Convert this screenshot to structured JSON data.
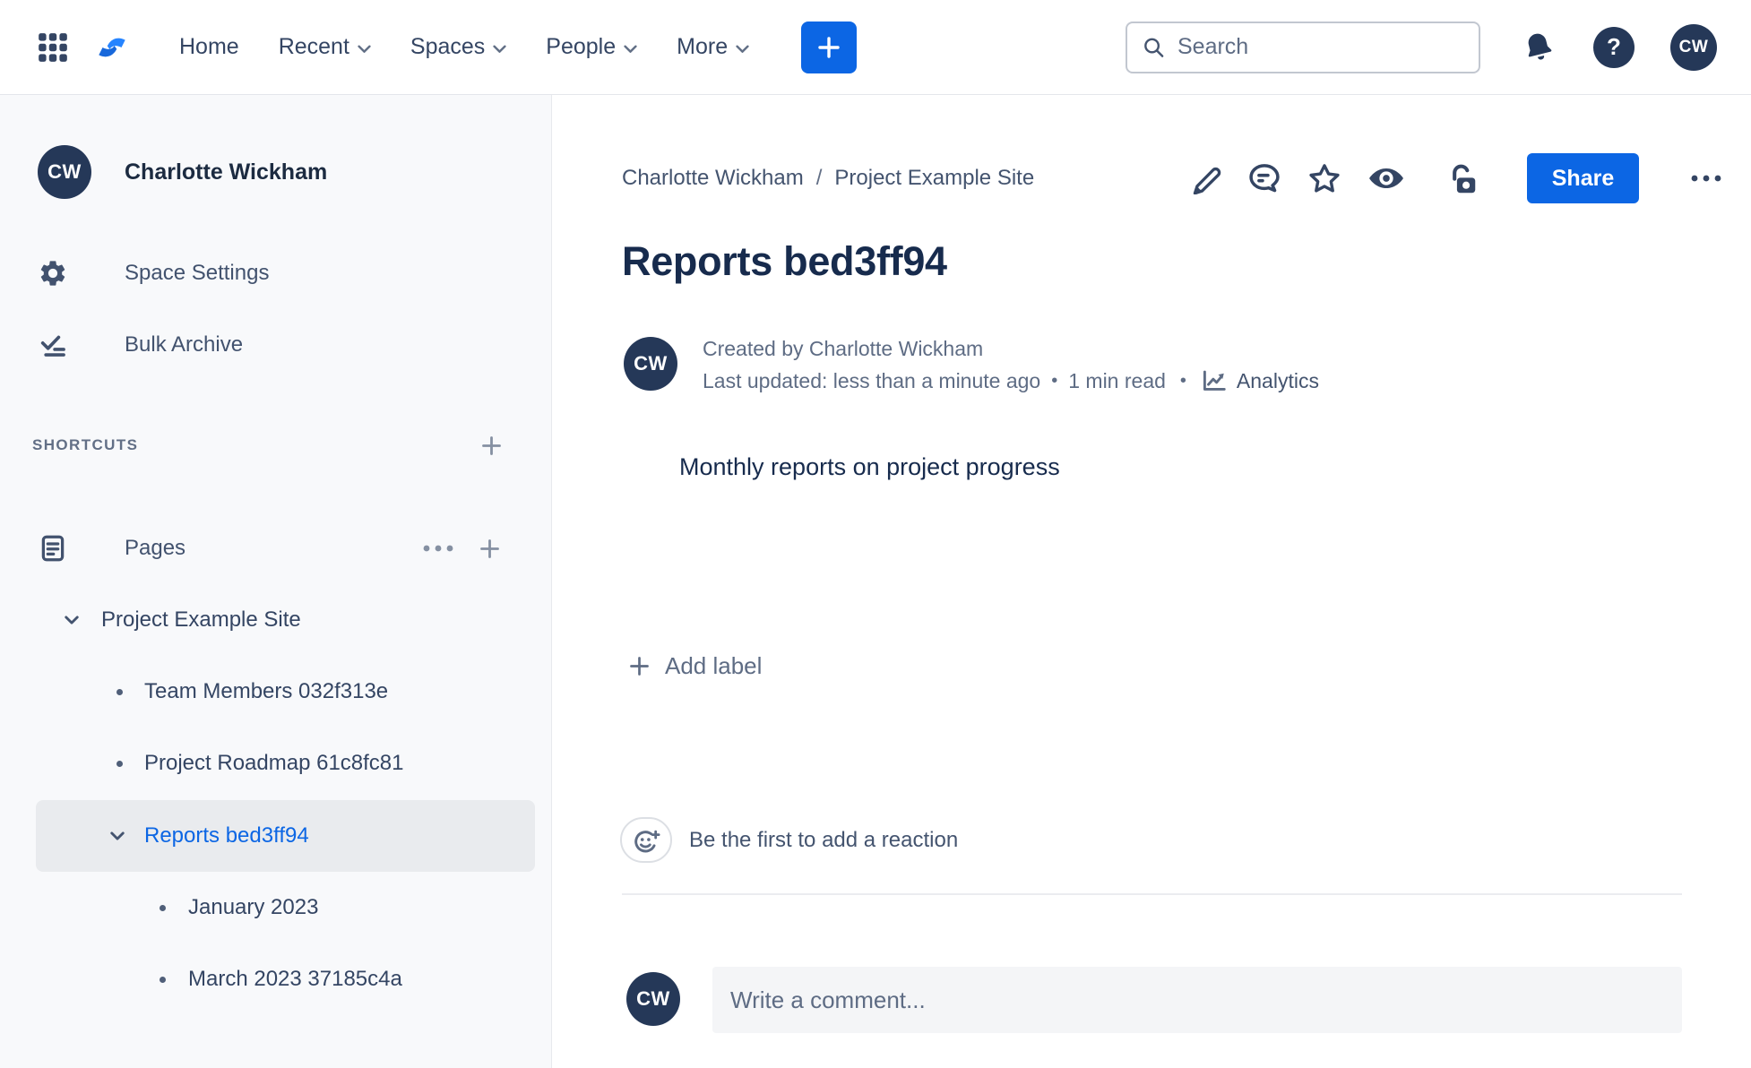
{
  "colors": {
    "accent": "#0C66E4",
    "title_text": "#172B4D",
    "nav_text": "#344563",
    "sidebar_text": "#42526E",
    "muted": "#5E6C84",
    "avatar_bg": "#253858",
    "sidebar_bg": "#F8F9FB",
    "selected_bg": "#E9EBEE",
    "border": "#E4E6EB",
    "divider": "#EBECF0",
    "comment_bg": "#F4F5F7",
    "logo_light": "#2684FF",
    "logo_dark": "#1868DB"
  },
  "topbar": {
    "nav": [
      {
        "label": "Home",
        "chevron": false
      },
      {
        "label": "Recent",
        "chevron": true
      },
      {
        "label": "Spaces",
        "chevron": true
      },
      {
        "label": "People",
        "chevron": true
      },
      {
        "label": "More",
        "chevron": true
      }
    ],
    "search": {
      "placeholder": "Search"
    },
    "profile_initials": "CW",
    "icons": {
      "app_switcher": "grid-9-dots",
      "logo": "confluence-mark",
      "create": "plus",
      "search": "magnifier",
      "notifications": "bell",
      "help_glyph": "?"
    }
  },
  "sidebar": {
    "space": {
      "initials": "CW",
      "name": "Charlotte Wickham"
    },
    "menu": [
      {
        "label": "Space Settings",
        "icon": "gear"
      },
      {
        "label": "Bulk Archive",
        "icon": "checklist"
      }
    ],
    "shortcuts_heading": "SHORTCUTS",
    "pages_label": "Pages",
    "tree": [
      {
        "label": "Project Example Site",
        "level": 0,
        "marker": "chevron",
        "selected": false
      },
      {
        "label": "Team Members 032f313e",
        "level": 1,
        "marker": "bullet",
        "selected": false
      },
      {
        "label": "Project Roadmap 61c8fc81",
        "level": 1,
        "marker": "bullet",
        "selected": false
      },
      {
        "label": "Reports bed3ff94",
        "level": 1,
        "marker": "chevron",
        "selected": true
      },
      {
        "label": "January 2023",
        "level": 2,
        "marker": "bullet",
        "selected": false
      },
      {
        "label": "March 2023 37185c4a",
        "level": 2,
        "marker": "bullet",
        "selected": false
      }
    ]
  },
  "content": {
    "breadcrumbs": [
      {
        "label": "Charlotte Wickham"
      },
      {
        "label": "Project Example Site"
      }
    ],
    "breadcrumb_separator": "/",
    "share_button": "Share",
    "title": "Reports bed3ff94",
    "byline": {
      "initials": "CW",
      "created": "Created by Charlotte Wickham",
      "updated": "Last updated: less than a minute ago",
      "separator": "•",
      "read_time": "1 min read",
      "analytics_label": "Analytics"
    },
    "body_text": "Monthly reports on project progress",
    "add_label": "Add label",
    "reaction_prompt": "Be the first to add a reaction",
    "comment": {
      "initials": "CW",
      "placeholder": "Write a comment..."
    }
  }
}
